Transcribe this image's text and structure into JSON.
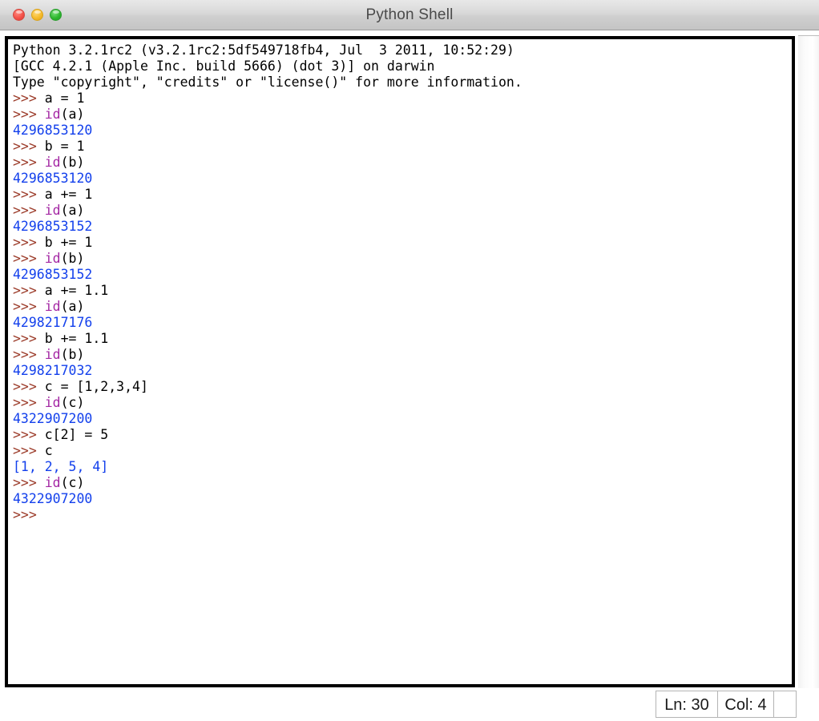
{
  "window": {
    "title": "Python Shell",
    "controls": {
      "close_label": "close-button",
      "minimize_label": "minimize-button",
      "maximize_label": "maximize-button"
    }
  },
  "colors": {
    "prompt": "#9b3a28",
    "builtin": "#a428a4",
    "output": "#1340ec",
    "code": "#000000",
    "banner": "#000000",
    "titlebar_text": "#4a4a4a",
    "close_button": "#f4524a",
    "minimize_button": "#f6bb2c",
    "maximize_button": "#2eb82e"
  },
  "console": {
    "lines": [
      {
        "segments": [
          {
            "class": "tok-banner",
            "text": "Python 3.2.1rc2 (v3.2.1rc2:5df549718fb4, Jul  3 2011, 10:52:29)"
          }
        ]
      },
      {
        "segments": [
          {
            "class": "tok-banner",
            "text": "[GCC 4.2.1 (Apple Inc. build 5666) (dot 3)] on darwin"
          }
        ]
      },
      {
        "segments": [
          {
            "class": "tok-banner",
            "text": "Type \"copyright\", \"credits\" or \"license()\" for more information."
          }
        ]
      },
      {
        "segments": [
          {
            "class": "tok-prompt",
            "text": ">>> "
          },
          {
            "class": "tok-code",
            "text": "a = 1"
          }
        ]
      },
      {
        "segments": [
          {
            "class": "tok-prompt",
            "text": ">>> "
          },
          {
            "class": "tok-builtin",
            "text": "id"
          },
          {
            "class": "tok-code",
            "text": "(a)"
          }
        ]
      },
      {
        "segments": [
          {
            "class": "tok-output",
            "text": "4296853120"
          }
        ]
      },
      {
        "segments": [
          {
            "class": "tok-prompt",
            "text": ">>> "
          },
          {
            "class": "tok-code",
            "text": "b = 1"
          }
        ]
      },
      {
        "segments": [
          {
            "class": "tok-prompt",
            "text": ">>> "
          },
          {
            "class": "tok-builtin",
            "text": "id"
          },
          {
            "class": "tok-code",
            "text": "(b)"
          }
        ]
      },
      {
        "segments": [
          {
            "class": "tok-output",
            "text": "4296853120"
          }
        ]
      },
      {
        "segments": [
          {
            "class": "tok-prompt",
            "text": ">>> "
          },
          {
            "class": "tok-code",
            "text": "a += 1"
          }
        ]
      },
      {
        "segments": [
          {
            "class": "tok-prompt",
            "text": ">>> "
          },
          {
            "class": "tok-builtin",
            "text": "id"
          },
          {
            "class": "tok-code",
            "text": "(a)"
          }
        ]
      },
      {
        "segments": [
          {
            "class": "tok-output",
            "text": "4296853152"
          }
        ]
      },
      {
        "segments": [
          {
            "class": "tok-prompt",
            "text": ">>> "
          },
          {
            "class": "tok-code",
            "text": "b += 1"
          }
        ]
      },
      {
        "segments": [
          {
            "class": "tok-prompt",
            "text": ">>> "
          },
          {
            "class": "tok-builtin",
            "text": "id"
          },
          {
            "class": "tok-code",
            "text": "(b)"
          }
        ]
      },
      {
        "segments": [
          {
            "class": "tok-output",
            "text": "4296853152"
          }
        ]
      },
      {
        "segments": [
          {
            "class": "tok-prompt",
            "text": ">>> "
          },
          {
            "class": "tok-code",
            "text": "a += 1.1"
          }
        ]
      },
      {
        "segments": [
          {
            "class": "tok-prompt",
            "text": ">>> "
          },
          {
            "class": "tok-builtin",
            "text": "id"
          },
          {
            "class": "tok-code",
            "text": "(a)"
          }
        ]
      },
      {
        "segments": [
          {
            "class": "tok-output",
            "text": "4298217176"
          }
        ]
      },
      {
        "segments": [
          {
            "class": "tok-prompt",
            "text": ">>> "
          },
          {
            "class": "tok-code",
            "text": "b += 1.1"
          }
        ]
      },
      {
        "segments": [
          {
            "class": "tok-prompt",
            "text": ">>> "
          },
          {
            "class": "tok-builtin",
            "text": "id"
          },
          {
            "class": "tok-code",
            "text": "(b)"
          }
        ]
      },
      {
        "segments": [
          {
            "class": "tok-output",
            "text": "4298217032"
          }
        ]
      },
      {
        "segments": [
          {
            "class": "tok-prompt",
            "text": ">>> "
          },
          {
            "class": "tok-code",
            "text": "c = [1,2,3,4]"
          }
        ]
      },
      {
        "segments": [
          {
            "class": "tok-prompt",
            "text": ">>> "
          },
          {
            "class": "tok-builtin",
            "text": "id"
          },
          {
            "class": "tok-code",
            "text": "(c)"
          }
        ]
      },
      {
        "segments": [
          {
            "class": "tok-output",
            "text": "4322907200"
          }
        ]
      },
      {
        "segments": [
          {
            "class": "tok-prompt",
            "text": ">>> "
          },
          {
            "class": "tok-code",
            "text": "c[2] = 5"
          }
        ]
      },
      {
        "segments": [
          {
            "class": "tok-prompt",
            "text": ">>> "
          },
          {
            "class": "tok-code",
            "text": "c"
          }
        ]
      },
      {
        "segments": [
          {
            "class": "tok-output",
            "text": "[1, 2, 5, 4]"
          }
        ]
      },
      {
        "segments": [
          {
            "class": "tok-prompt",
            "text": ">>> "
          },
          {
            "class": "tok-builtin",
            "text": "id"
          },
          {
            "class": "tok-code",
            "text": "(c)"
          }
        ]
      },
      {
        "segments": [
          {
            "class": "tok-output",
            "text": "4322907200"
          }
        ]
      },
      {
        "segments": [
          {
            "class": "tok-prompt",
            "text": ">>> "
          }
        ]
      }
    ]
  },
  "statusbar": {
    "line_label": "Ln: 30",
    "column_label": "Col: 4"
  }
}
